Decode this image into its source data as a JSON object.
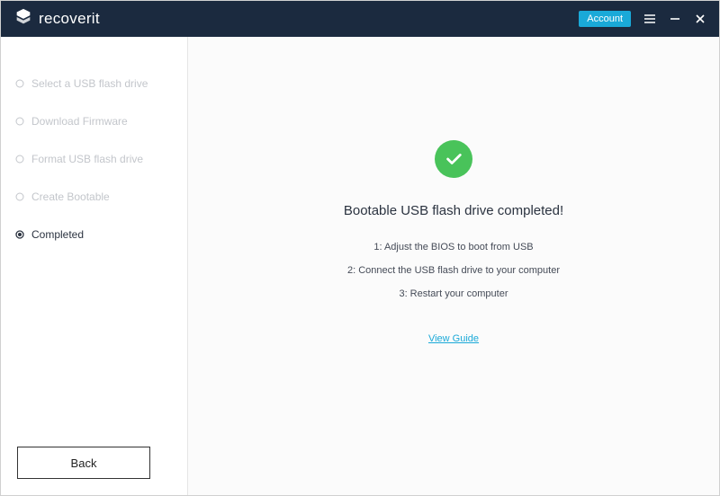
{
  "titlebar": {
    "brand": "recoverit",
    "account_label": "Account"
  },
  "sidebar": {
    "steps": [
      {
        "label": "Select a USB flash drive",
        "active": false
      },
      {
        "label": "Download Firmware",
        "active": false
      },
      {
        "label": "Format USB flash drive",
        "active": false
      },
      {
        "label": "Create Bootable",
        "active": false
      },
      {
        "label": "Completed",
        "active": true
      }
    ],
    "back_label": "Back"
  },
  "main": {
    "headline": "Bootable USB flash drive completed!",
    "instructions": [
      "1: Adjust the BIOS to boot from USB",
      "2: Connect the USB flash drive to your computer",
      "3: Restart your computer"
    ],
    "guide_link": "View Guide"
  }
}
